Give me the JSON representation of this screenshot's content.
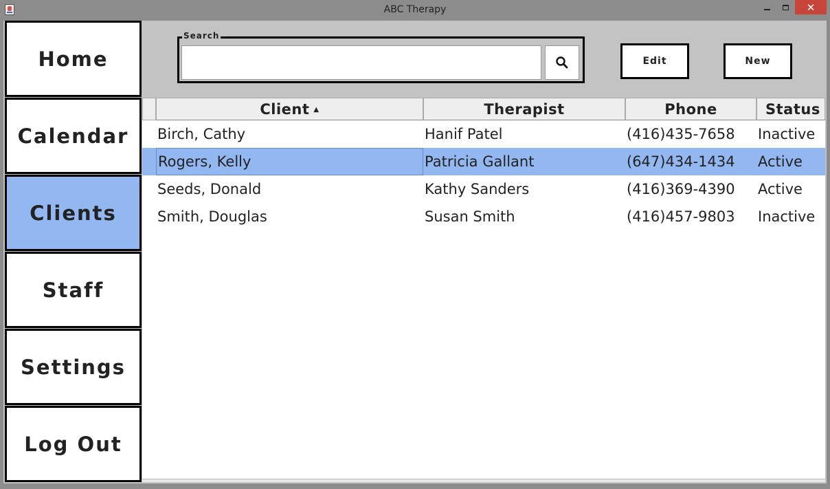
{
  "window": {
    "title": "ABC Therapy",
    "close_glyph": "✕"
  },
  "sidebar": {
    "items": [
      {
        "label": "Home",
        "active": false
      },
      {
        "label": "Calendar",
        "active": false
      },
      {
        "label": "Clients",
        "active": true
      },
      {
        "label": "Staff",
        "active": false
      },
      {
        "label": "Settings",
        "active": false
      },
      {
        "label": "Log Out",
        "active": false
      }
    ]
  },
  "search": {
    "legend": "Search",
    "value": "",
    "placeholder": "",
    "button_icon": "search-icon"
  },
  "toolbar": {
    "edit_label": "Edit",
    "new_label": "New"
  },
  "table": {
    "columns": [
      {
        "label": "Client",
        "sort": "ascending"
      },
      {
        "label": "Therapist"
      },
      {
        "label": "Phone"
      },
      {
        "label": "Status"
      }
    ],
    "sort_arrow": "▲",
    "rows": [
      {
        "client": "Birch, Cathy",
        "therapist": "Hanif Patel",
        "phone": "(416)435-7658",
        "status": "Inactive",
        "selected": false
      },
      {
        "client": "Rogers, Kelly",
        "therapist": "Patricia Gallant",
        "phone": "(647)434-1434",
        "status": "Active",
        "selected": true
      },
      {
        "client": "Seeds, Donald",
        "therapist": "Kathy Sanders",
        "phone": "(416)369-4390",
        "status": "Active",
        "selected": false
      },
      {
        "client": "Smith, Douglas",
        "therapist": "Susan Smith",
        "phone": "(416)457-9803",
        "status": "Inactive",
        "selected": false
      }
    ]
  },
  "colors": {
    "active_nav": "#93b7f0",
    "selected_row": "#93b7f0",
    "frame_background": "#c3c3c3",
    "close_button": "#c7453a"
  }
}
